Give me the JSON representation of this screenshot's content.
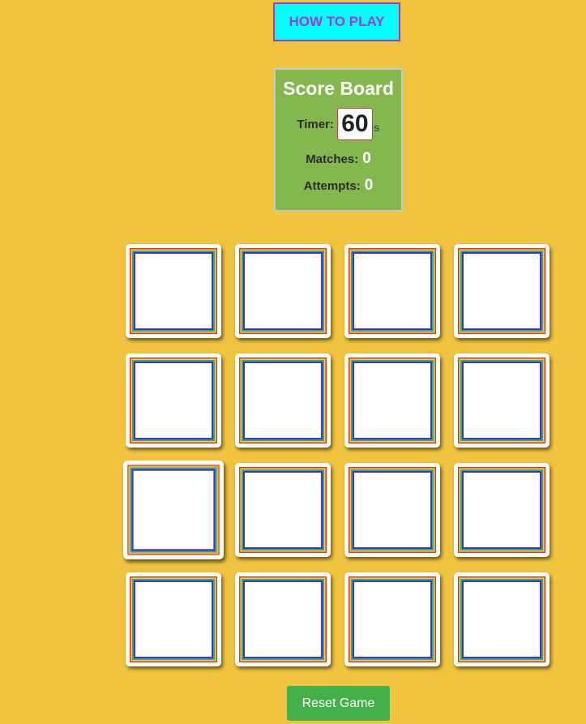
{
  "how_to_play": {
    "label": "HOW TO PLAY"
  },
  "scoreboard": {
    "title": "Score Board",
    "timer_label": "Timer:",
    "timer_value": "60",
    "timer_unit": "s",
    "matches_label": "Matches:",
    "matches_value": "0",
    "attempts_label": "Attempts:",
    "attempts_value": "0"
  },
  "board": {
    "rows": 4,
    "columns": 4,
    "cards_face_down": 16
  },
  "reset": {
    "label": "Reset Game"
  },
  "colors": {
    "background": "#f0c43e",
    "how_to_play_bg": "#00ffff",
    "how_to_play_text": "#a23bd6",
    "scoreboard_bg": "#84b84e",
    "reset_bg": "#44b04a"
  }
}
